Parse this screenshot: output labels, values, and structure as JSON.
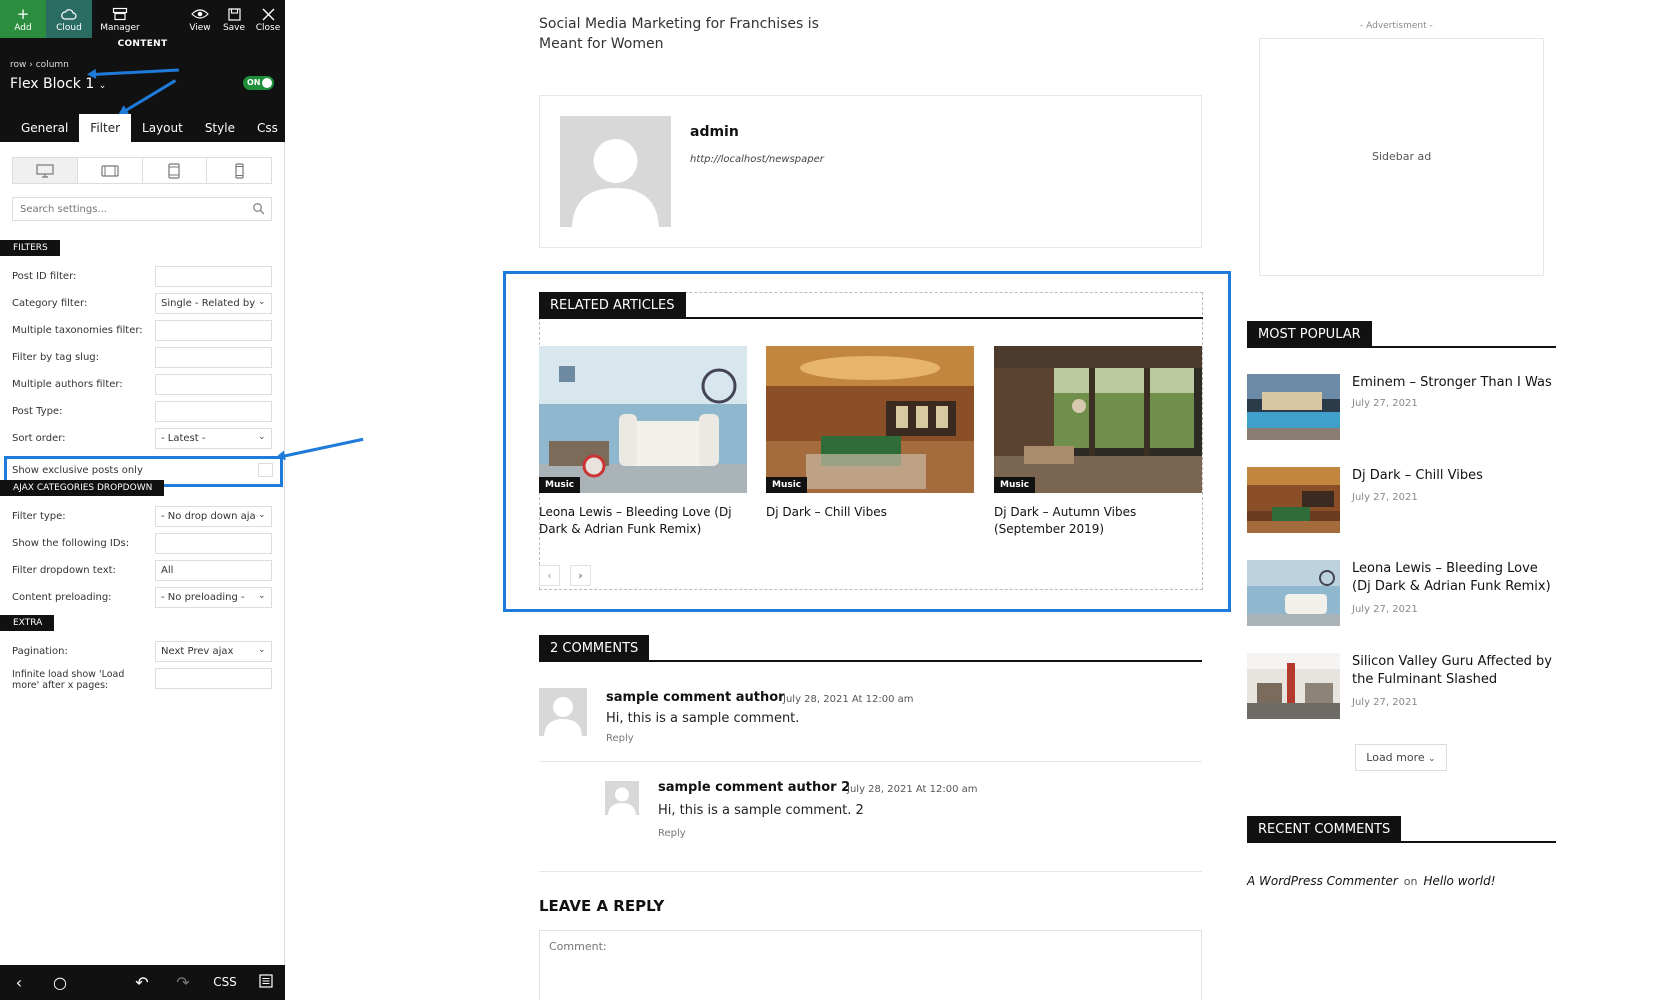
{
  "editor": {
    "toolbar": {
      "add": "Add",
      "cloud": "Cloud",
      "manager": "Manager",
      "view": "View",
      "save": "Save",
      "close": "Close"
    },
    "content_label": "CONTENT",
    "breadcrumb": {
      "row": "row",
      "sep": "›",
      "column": "column"
    },
    "block_name": "Flex Block 1",
    "toggle": "ON",
    "tabs": [
      "General",
      "Filter",
      "Layout",
      "Style",
      "Css"
    ],
    "active_tab": "Filter",
    "search_placeholder": "Search settings...",
    "sections": {
      "filters": "FILTERS",
      "ajax": "AJAX CATEGORIES DROPDOWN",
      "extra": "EXTRA"
    },
    "fields": {
      "post_id": {
        "label": "Post ID filter:",
        "value": ""
      },
      "category": {
        "label": "Category filter:",
        "value": "Single - Related by"
      },
      "multi_tax": {
        "label": "Multiple taxonomies filter:",
        "value": ""
      },
      "tag_slug": {
        "label": "Filter by tag slug:",
        "value": ""
      },
      "multi_authors": {
        "label": "Multiple authors filter:",
        "value": ""
      },
      "post_type": {
        "label": "Post Type:",
        "value": ""
      },
      "sort_order": {
        "label": "Sort order:",
        "value": "- Latest -"
      },
      "exclusive": {
        "label": "Show exclusive posts only"
      },
      "filter_type": {
        "label": "Filter type:",
        "value": "- No drop down aja"
      },
      "show_ids": {
        "label": "Show the following IDs:",
        "value": ""
      },
      "dropdown_text": {
        "label": "Filter dropdown text:",
        "value": "All"
      },
      "preloading": {
        "label": "Content preloading:",
        "value": "- No preloading -"
      },
      "pagination": {
        "label": "Pagination:",
        "value": "Next Prev ajax"
      },
      "infinite_load": {
        "label": "Infinite load show 'Load more' after x pages:",
        "value": ""
      }
    },
    "bottom_css": "CSS"
  },
  "article": {
    "post_title": "Social Media Marketing for Franchises is Meant for Women",
    "author": {
      "name": "admin",
      "url": "http://localhost/newspaper"
    },
    "related": {
      "heading": "RELATED ARTICLES",
      "items": [
        {
          "category": "Music",
          "title": "Leona Lewis – Bleeding Love (Dj Dark & Adrian Funk Remix)"
        },
        {
          "category": "Music",
          "title": "Dj Dark – Chill Vibes"
        },
        {
          "category": "Music",
          "title": "Dj Dark – Autumn Vibes (September 2019)"
        }
      ],
      "prev": "‹",
      "next": "›"
    },
    "comments": {
      "heading": "2 COMMENTS",
      "items": [
        {
          "author": "sample comment author",
          "date": "July 28, 2021 At 12:00 am",
          "text": "Hi, this is a sample comment.",
          "reply": "Reply"
        },
        {
          "author": "sample comment author 2",
          "date": "July 28, 2021 At 12:00 am",
          "text": "Hi, this is a sample comment. 2",
          "reply": "Reply"
        }
      ]
    },
    "leave_reply": "LEAVE A REPLY",
    "comment_placeholder": "Comment:"
  },
  "sidebar": {
    "ad_label": "- Advertisment -",
    "ad_text": "Sidebar ad",
    "most_popular": {
      "heading": "MOST POPULAR",
      "items": [
        {
          "title": "Eminem – Stronger Than I Was",
          "date": "July 27, 2021"
        },
        {
          "title": "Dj Dark – Chill Vibes",
          "date": "July 27, 2021"
        },
        {
          "title": "Leona Lewis – Bleeding Love (Dj Dark & Adrian Funk Remix)",
          "date": "July 27, 2021"
        },
        {
          "title": "Silicon Valley Guru Affected by the Fulminant Slashed",
          "date": "July 27, 2021"
        }
      ],
      "load_more": "Load more"
    },
    "recent_comments": {
      "heading": "RECENT COMMENTS",
      "commenter": "A WordPress Commenter",
      "on": "on",
      "post": "Hello world!"
    }
  },
  "colors": {
    "accent": "#1f7bd9",
    "header_bg": "#111111",
    "add_green": "#2b8e3e",
    "toggle_green": "#1d8f3a"
  }
}
